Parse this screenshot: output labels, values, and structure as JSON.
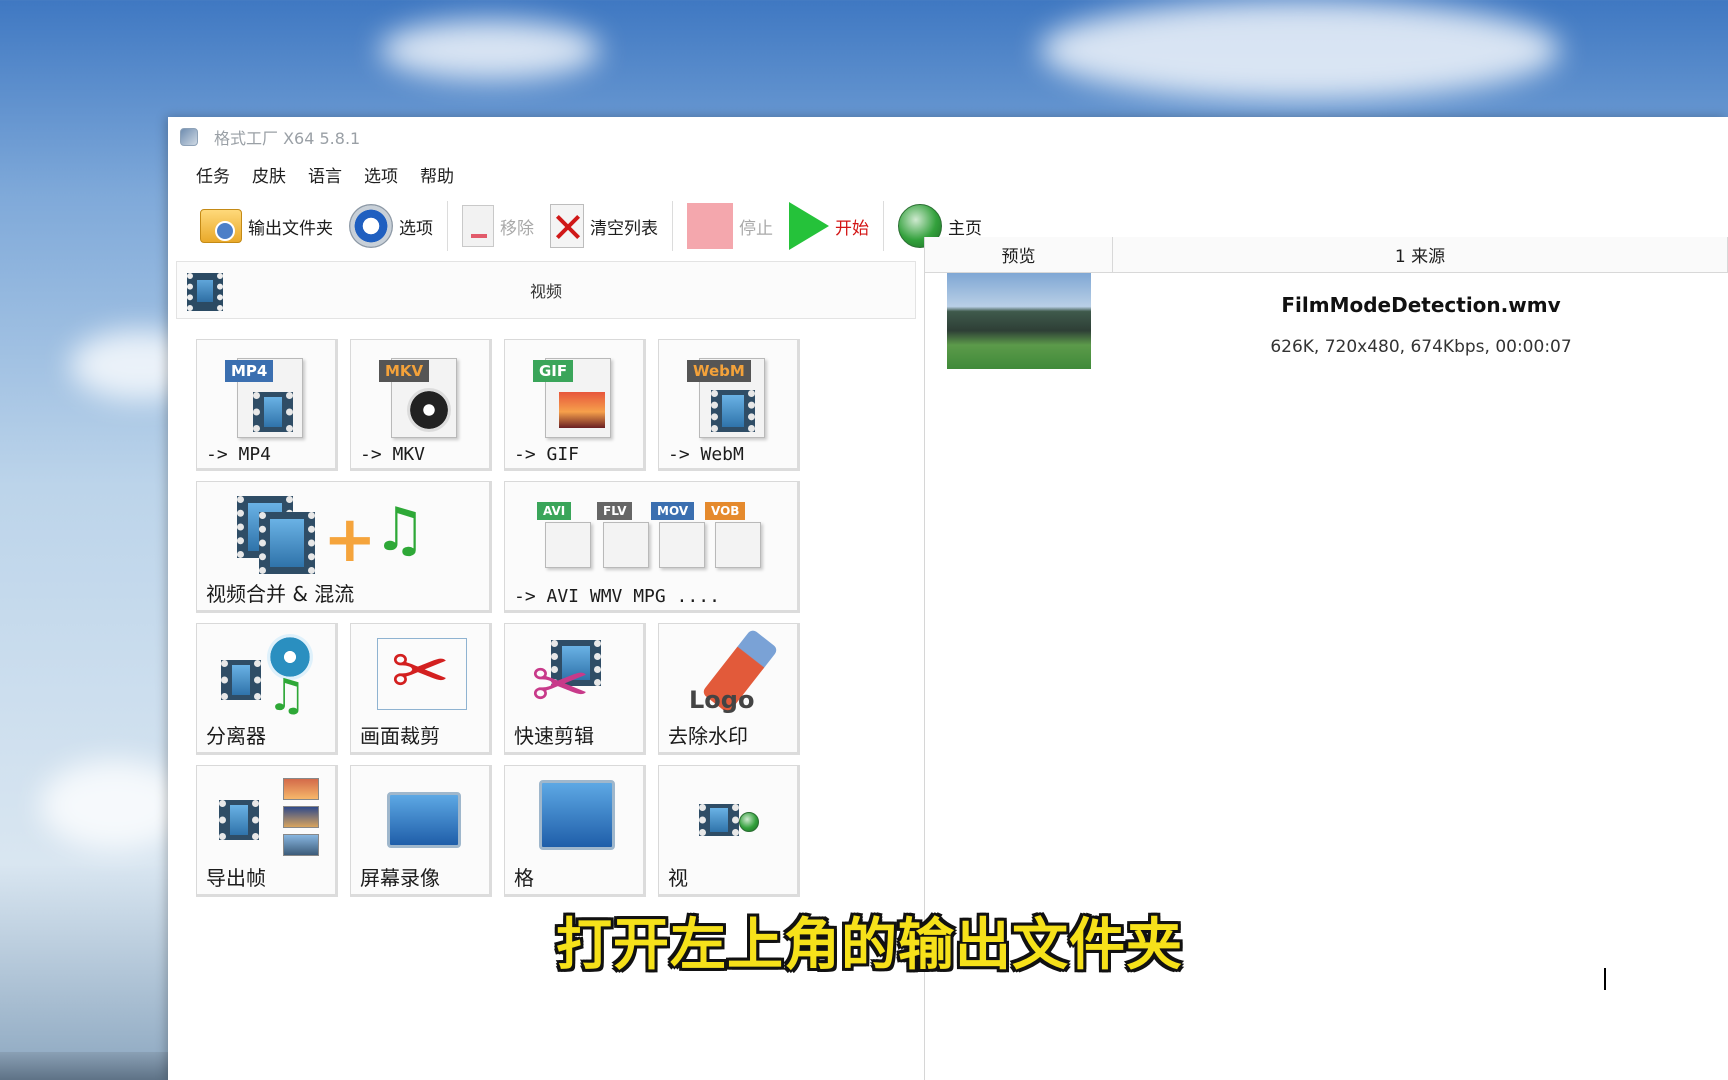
{
  "window": {
    "title": "格式工厂 X64 5.8.1"
  },
  "menu": [
    "任务",
    "皮肤",
    "语言",
    "选项",
    "帮助"
  ],
  "toolbar": {
    "output_folder": "输出文件夹",
    "options": "选项",
    "remove": "移除",
    "clear_list": "清空列表",
    "stop": "停止",
    "start": "开始",
    "home": "主页"
  },
  "category": {
    "label": "视频"
  },
  "tiles": {
    "mp4": {
      "label": "-> MP4",
      "badge": "MP4"
    },
    "mkv": {
      "label": "-> MKV",
      "badge": "MKV"
    },
    "gif": {
      "label": "-> GIF",
      "badge": "GIF"
    },
    "webm": {
      "label": "-> WebM",
      "badge": "WebM"
    },
    "merge": {
      "label": "视频合并 & 混流"
    },
    "others": {
      "label": "-> AVI WMV MPG ....",
      "badges": [
        "AVI",
        "FLV",
        "MOV",
        "VOB"
      ]
    },
    "splitter": {
      "label": "分离器"
    },
    "crop": {
      "label": "画面裁剪"
    },
    "quick_clip": {
      "label": "快速剪辑"
    },
    "watermark": {
      "label": "去除水印",
      "logo_text": "Logo"
    },
    "export_frames": {
      "label": "导出帧"
    },
    "screen_record": {
      "label": "屏幕录像"
    },
    "tile_11": {
      "label": "格"
    },
    "tile_12": {
      "label": "视"
    }
  },
  "file_list": {
    "columns": {
      "preview": "预览",
      "source": "1 来源"
    },
    "rows": [
      {
        "name": "FilmModeDetection.wmv",
        "meta": "626K, 720x480, 674Kbps, 00:00:07"
      }
    ]
  },
  "subtitle": "打开左上角的输出文件夹",
  "colors": {
    "accent_start": "#25c23a",
    "stop_disabled": "#f4a7ad",
    "subtitle": "#f6e11a"
  }
}
